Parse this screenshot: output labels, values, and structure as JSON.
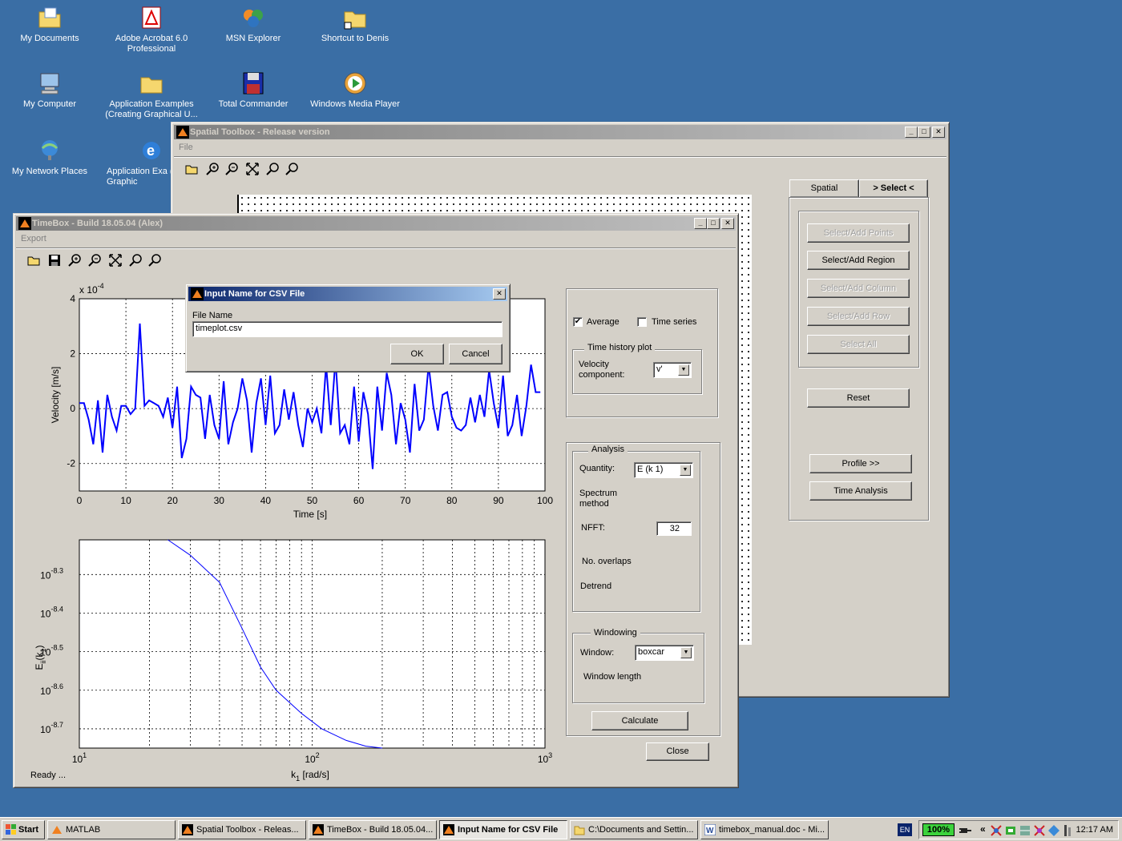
{
  "desktop": {
    "icons": [
      {
        "label": "My Documents",
        "icon": "folder-documents-icon"
      },
      {
        "label": "Adobe Acrobat 6.0 Professional",
        "icon": "acrobat-icon"
      },
      {
        "label": "MSN Explorer",
        "icon": "msn-icon"
      },
      {
        "label": "Shortcut to Denis",
        "icon": "folder-shortcut-icon"
      },
      {
        "label": "My Computer",
        "icon": "computer-icon"
      },
      {
        "label": "Application Examples (Creating Graphical U...",
        "icon": "folder-icon"
      },
      {
        "label": "Total Commander",
        "icon": "floppy-icon"
      },
      {
        "label": "Windows Media Player",
        "icon": "media-player-icon"
      },
      {
        "label": "My Network Places",
        "icon": "network-icon"
      },
      {
        "label": "Application Exa (Creating Graphic",
        "icon": "ie-icon"
      }
    ]
  },
  "spatial": {
    "title": "Spatial Toolbox - Release version",
    "menu": "File",
    "tab_spatial": "Spatial",
    "tab_select": "> Select <",
    "btn_points": "Select/Add Points",
    "btn_region": "Select/Add Region",
    "btn_column": "Select/Add Column",
    "btn_row": "Select/Add Row",
    "btn_all": "Select All",
    "btn_reset": "Reset",
    "btn_profile": "Profile >>",
    "btn_time": "Time Analysis"
  },
  "timebox": {
    "title": "TimeBox - Build 18.05.04 (Alex)",
    "menu": "Export",
    "status": "Ready ...",
    "average_label": "Average",
    "average_checked": true,
    "timeseries_label": "Time series",
    "timeseries_checked": false,
    "time_history_legend": "Time history plot",
    "velocity_component_label": "Velocity component:",
    "velocity_component_value": "v'",
    "analysis_legend": "Analysis",
    "quantity_label": "Quantity:",
    "quantity_value": "E (k 1)",
    "spectrum_label": "Spectrum method",
    "nfft_label": "NFFT:",
    "nfft_value": "32",
    "overlaps_label": "No. overlaps",
    "detrend_label": "Detrend",
    "windowing_legend": "Windowing",
    "window_label": "Window:",
    "window_value": "boxcar",
    "window_length_label": "Window length",
    "calculate": "Calculate",
    "close": "Close"
  },
  "dialog": {
    "title": "Input Name for CSV File",
    "field_label": "File Name",
    "field_value": "timeplot.csv",
    "ok": "OK",
    "cancel": "Cancel"
  },
  "taskbar": {
    "start": "Start",
    "tasks": [
      "MATLAB",
      "Spatial Toolbox - Releas...",
      "TimeBox - Build 18.05.04...",
      "Input Name for CSV File",
      "C:\\Documents and Settin...",
      "timebox_manual.doc - Mi..."
    ],
    "lang": "EN",
    "battery": "100%",
    "clock": "12:17 AM"
  },
  "chart_data": [
    {
      "type": "line",
      "title": "",
      "xlabel": "Time [s]",
      "ylabel": "Velocity [m/s]",
      "y_multiplier": "x 10^-4",
      "xlim": [
        0,
        100
      ],
      "ylim": [
        -3,
        4
      ],
      "xticks": [
        0,
        10,
        20,
        30,
        40,
        50,
        60,
        70,
        80,
        90,
        100
      ],
      "yticks": [
        -2,
        0,
        2,
        4
      ],
      "grid": true,
      "color": "#0000ff",
      "series": [
        {
          "x": [
            0,
            1,
            2,
            3,
            4,
            5,
            6,
            7,
            8,
            9,
            10,
            11,
            12,
            13,
            14,
            15,
            16,
            17,
            18,
            19,
            20,
            21,
            22,
            23,
            24,
            25,
            26,
            27,
            28,
            29,
            30,
            31,
            32,
            33,
            34,
            35,
            36,
            37,
            38,
            39,
            40,
            41,
            42,
            43,
            44,
            45,
            46,
            47,
            48,
            49,
            50,
            51,
            52,
            53,
            54,
            55,
            56,
            57,
            58,
            59,
            60,
            61,
            62,
            63,
            64,
            65,
            66,
            67,
            68,
            69,
            70,
            71,
            72,
            73,
            74,
            75,
            76,
            77,
            78,
            79,
            80,
            81,
            82,
            83,
            84,
            85,
            86,
            87,
            88,
            89,
            90,
            91,
            92,
            93,
            94,
            95,
            96,
            97,
            98,
            99
          ],
          "y": [
            0.2,
            0.2,
            -0.4,
            -1.3,
            0.3,
            -1.6,
            0.5,
            -0.3,
            -0.8,
            0.1,
            0.1,
            -0.2,
            0.0,
            3.1,
            0.1,
            0.3,
            0.2,
            0.1,
            -0.3,
            0.4,
            -0.7,
            0.8,
            -1.8,
            -1.1,
            0.8,
            0.5,
            0.4,
            -1.1,
            0.5,
            -0.6,
            -1.1,
            1.0,
            -1.3,
            -0.5,
            0.0,
            1.1,
            0.3,
            -1.6,
            0.2,
            1.1,
            -0.6,
            1.2,
            -0.9,
            -0.6,
            0.7,
            -0.4,
            0.6,
            -0.6,
            -1.4,
            0.0,
            -0.5,
            0.0,
            -0.9,
            1.6,
            -0.6,
            1.8,
            -0.9,
            -0.6,
            -1.3,
            0.8,
            -1.2,
            0.6,
            -0.2,
            -2.2,
            0.8,
            -0.8,
            1.3,
            0.5,
            -1.3,
            0.2,
            -0.4,
            -1.6,
            0.9,
            -0.8,
            -0.4,
            1.6,
            0.1,
            -0.8,
            0.5,
            0.6,
            -0.3,
            -0.7,
            -0.8,
            -0.6,
            0.4,
            -0.5,
            0.5,
            -0.3,
            1.4,
            0.2,
            -0.7,
            1.2,
            -1.0,
            -0.6,
            0.5,
            -1.0,
            0.1,
            1.6,
            0.6,
            0.6
          ]
        }
      ]
    },
    {
      "type": "line",
      "title": "",
      "xlabel": "k1 [rad/s]",
      "ylabel": "Eii(k1)",
      "xscale": "log",
      "yscale": "log",
      "xlim": [
        10,
        1000
      ],
      "ylim_exponent": [
        -8.75,
        -8.21
      ],
      "xtick_labels": [
        "10^1",
        "10^2",
        "10^3"
      ],
      "ytick_labels": [
        "10^-8.3",
        "10^-8.4",
        "10^-8.5",
        "10^-8.6",
        "10^-8.7"
      ],
      "grid": true,
      "color": "#0000ff",
      "series": [
        {
          "x": [
            24,
            30,
            40,
            50,
            60,
            70,
            90,
            110,
            140,
            170,
            200
          ],
          "y_exponent": [
            -8.21,
            -8.25,
            -8.32,
            -8.44,
            -8.54,
            -8.6,
            -8.66,
            -8.7,
            -8.73,
            -8.745,
            -8.75
          ]
        }
      ]
    }
  ]
}
